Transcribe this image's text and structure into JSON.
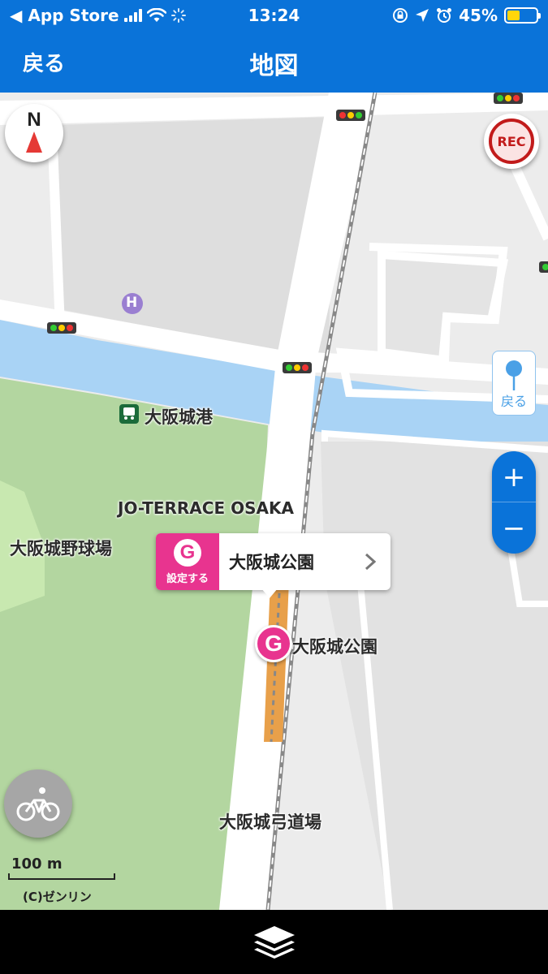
{
  "status_bar": {
    "back_app": "◀ App Store",
    "time": "13:24",
    "battery": "45%",
    "battery_level": 0.45
  },
  "nav": {
    "back_label": "戻る",
    "title": "地図"
  },
  "map": {
    "compass_label": "N",
    "rec_label": "REC",
    "pin_back_label": "戻る",
    "zoom_in": "+",
    "zoom_out": "−",
    "labels": {
      "port": "大阪城港",
      "terrace": "JO-TERRACE OSAKA",
      "baseball": "大阪城野球場",
      "goal_place": "大阪城公園",
      "kyudo": "大阪城弓道場",
      "hospital": "H"
    },
    "goal_card": {
      "badge": "G",
      "set_label": "設定する",
      "name": "大阪城公園",
      "chevron": "›"
    },
    "goal_marker": "G",
    "scale_label": "100 m",
    "copyright": "(C)ゼンリン",
    "colors": {
      "water": "#a9d3f5",
      "park": "#b3d6a0",
      "road": "#ffffff",
      "block": "#dcdcdc",
      "route": "#e8a04a",
      "goal": "#e8348f",
      "accent": "#0a73d9"
    }
  },
  "bottom_bar": {
    "layers_icon": "layers-icon"
  }
}
